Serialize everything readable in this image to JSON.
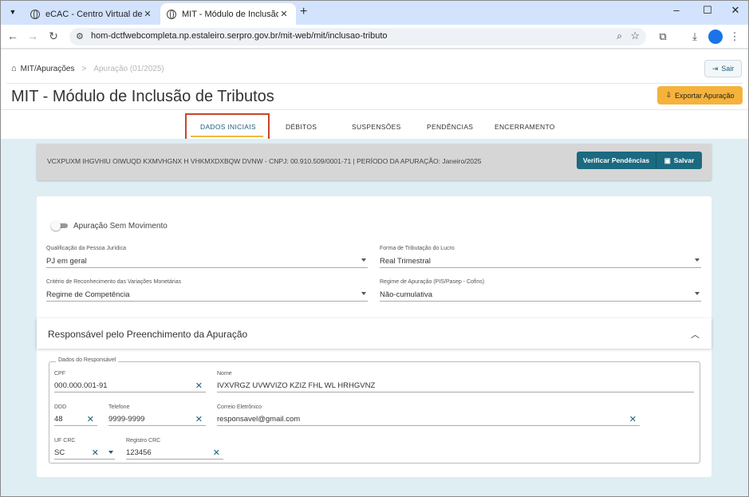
{
  "browser": {
    "tabs": [
      {
        "title": "eCAC - Centro Virtual de Atend",
        "active": false
      },
      {
        "title": "MIT - Módulo de Inclusão de Tri",
        "active": true
      }
    ],
    "url": "hom-dctfwebcompleta.np.estaleiro.serpro.gov.br/mit-web/mit/inclusao-tributo"
  },
  "header": {
    "breadcrumb": {
      "root": "MIT/Apurações",
      "current": "Apuração (01/2025)"
    },
    "sair_label": "Sair",
    "page_title": "MIT - Módulo de Inclusão de Tributos",
    "export_label": "Exportar Apuração"
  },
  "tabs": [
    {
      "label": "DADOS INICIAIS",
      "active": true
    },
    {
      "label": "DÉBITOS",
      "active": false
    },
    {
      "label": "SUSPENSÕES",
      "active": false
    },
    {
      "label": "PENDÊNCIAS",
      "active": false
    },
    {
      "label": "ENCERRAMENTO",
      "active": false
    }
  ],
  "infobar": {
    "text": "VCXPUXM IHGVHIU OIWUQD KXMVHGNX H VHKMXDXBQW DVNW - CNPJ: 00.910.509/0001-71   |   PERÍODO DA APURAÇÃO: Janeiro/2025",
    "verificar_label": "Verificar Pendências",
    "salvar_label": "Salvar"
  },
  "form": {
    "toggle_label": "Apuração Sem Movimento",
    "toggle_on": false,
    "qualificacao": {
      "label": "Qualificação da Pessoa Jurídica",
      "value": "PJ em geral"
    },
    "forma_tributacao": {
      "label": "Forma de Tributação do Lucro",
      "value": "Real Trimestral"
    },
    "criterio": {
      "label": "Critério de Reconhecimento das Variações Monetárias",
      "value": "Regime de Competência"
    },
    "regime_apuracao": {
      "label": "Regime de Apuração (PIS/Pasep - Cofins)",
      "value": "Não-cumulativa"
    }
  },
  "responsavel": {
    "section_title": "Responsável pelo Preenchimento da Apuração",
    "legend": "Dados do Responsável",
    "cpf": {
      "label": "CPF",
      "value": "000.000.001-91"
    },
    "nome": {
      "label": "Nome",
      "value": "IVXVRGZ UVWVIZO KZIZ FHL WL HRHGVNZ"
    },
    "ddd": {
      "label": "DDD",
      "value": "48"
    },
    "telefone": {
      "label": "Telefone",
      "value": "9999-9999"
    },
    "email": {
      "label": "Correio Eletrônico",
      "value": "responsavel@gmail.com"
    },
    "uf_crc": {
      "label": "UF CRC",
      "value": "SC"
    },
    "registro_crc": {
      "label": "Registro CRC",
      "value": "123456"
    }
  },
  "colors": {
    "primary": "#1b6a80",
    "accent": "#f5b33b",
    "highlight_box": "#c9452c",
    "content_bg": "#dfeef2"
  }
}
